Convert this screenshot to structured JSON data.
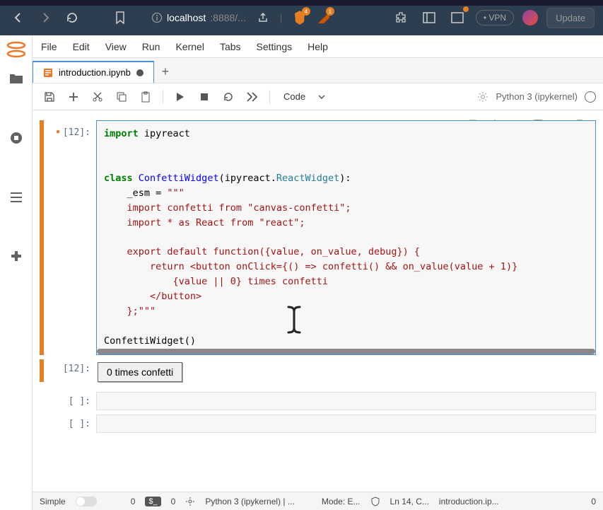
{
  "browser": {
    "url_host": "localhost",
    "url_port": ":8888/...",
    "vpn_label": "VPN",
    "update_label": "Update",
    "ext1_badge": "4",
    "ext2_badge": "1"
  },
  "menu": {
    "file": "File",
    "edit": "Edit",
    "view": "View",
    "run": "Run",
    "kernel": "Kernel",
    "tabs": "Tabs",
    "settings": "Settings",
    "help": "Help"
  },
  "tabs": {
    "file_name": "introduction.ipynb"
  },
  "toolbar": {
    "cell_type": "Code",
    "kernel_name": "Python 3 (ipykernel)"
  },
  "cells": {
    "code1": {
      "prompt": "[12]:",
      "code_lines": [
        {
          "t": "import ",
          "c": "kw"
        },
        {
          "t": "ipyreact\n\n\n"
        },
        {
          "t": "class ",
          "c": "kw"
        },
        {
          "t": "ConfettiWidget",
          "c": "cls"
        },
        {
          "t": "(ipyreact."
        },
        {
          "t": "ReactWidget",
          "c": "react-class"
        },
        {
          "t": "):\n"
        },
        {
          "t": "    _esm = "
        },
        {
          "t": "\"\"\"",
          "c": "str"
        },
        {
          "t": "\n"
        },
        {
          "t": "    import confetti from \"canvas-confetti\";",
          "c": "str"
        },
        {
          "t": "\n"
        },
        {
          "t": "    import * as React from \"react\";",
          "c": "str"
        },
        {
          "t": "\n\n"
        },
        {
          "t": "    export default function({value, on_value, debug}) {",
          "c": "str"
        },
        {
          "t": "\n"
        },
        {
          "t": "        return <button onClick={() => confetti() && on_value(value + 1)}",
          "c": "str"
        },
        {
          "t": "\n"
        },
        {
          "t": "            {value || 0} times confetti",
          "c": "str"
        },
        {
          "t": "\n"
        },
        {
          "t": "        </button>",
          "c": "str"
        },
        {
          "t": "\n"
        },
        {
          "t": "    };",
          "c": "str"
        },
        {
          "t": "\"\"\"",
          "c": "str"
        },
        {
          "t": "\n\n"
        },
        {
          "t": "ConfettiWidget()"
        }
      ]
    },
    "output1": {
      "prompt": "[12]:",
      "button_text": "0 times confetti"
    },
    "empty1": {
      "prompt": "[ ]:"
    },
    "empty2": {
      "prompt": "[ ]:"
    }
  },
  "status": {
    "simple": "Simple",
    "n0a": "0",
    "n_box": "$_",
    "n0b": "0",
    "kernel_long": "Python 3 (ipykernel) | ...",
    "mode": "Mode: E...",
    "ln": "Ln 14, C...",
    "filename": "introduction.ip...",
    "tail": "0"
  },
  "icons": {
    "search": "search-icon",
    "shield": "shield-icon"
  }
}
